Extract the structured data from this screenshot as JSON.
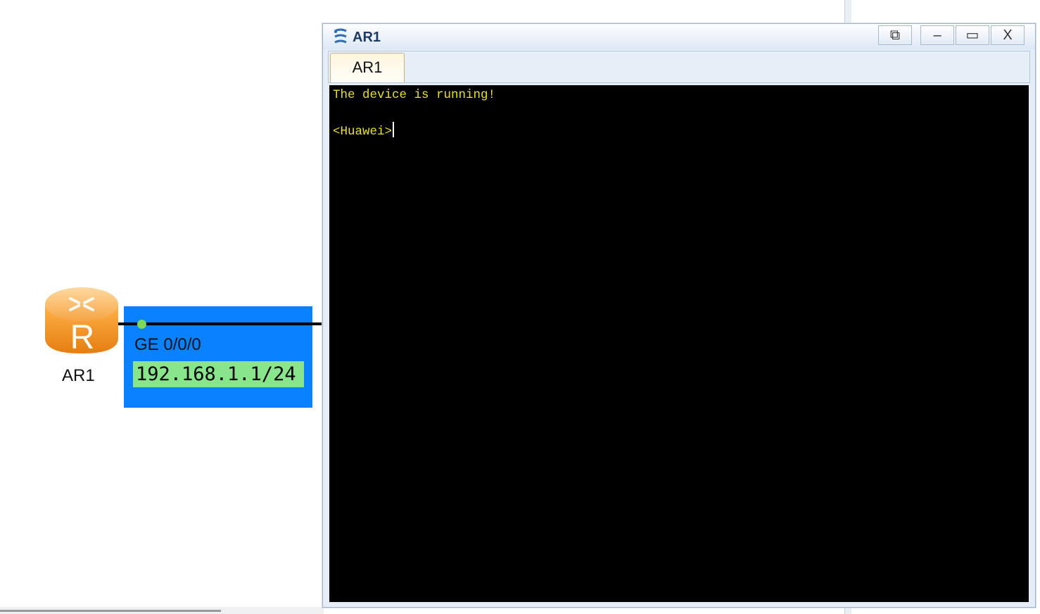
{
  "topology": {
    "router": {
      "label": "AR1",
      "badge": "R"
    },
    "interface": {
      "name": "GE 0/0/0",
      "ip": "192.168.1.1/24"
    }
  },
  "console_window": {
    "title": "AR1",
    "tab": "AR1",
    "buttons": {
      "restore_glyph": "⧉",
      "minimize_glyph": "–",
      "maximize_glyph": "▭",
      "close_glyph": "X"
    },
    "terminal": {
      "line1": "The device is running!",
      "prompt": "<Huawei>"
    }
  },
  "colors": {
    "interface_box": "#0a82ff",
    "ip_highlight": "#89e58b",
    "terminal_text": "#e8e02a",
    "terminal_bg": "#000000",
    "router_orange": "#f39a2c"
  }
}
